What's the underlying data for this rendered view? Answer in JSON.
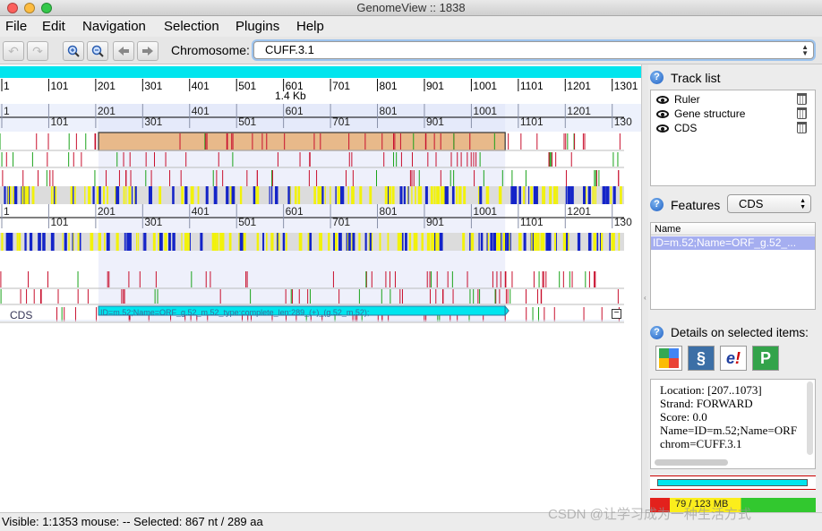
{
  "window": {
    "title": "GenomeView :: 1838"
  },
  "menu": [
    "File",
    "Edit",
    "Navigation",
    "Selection",
    "Plugins",
    "Help"
  ],
  "toolbar": {
    "buttons": [
      "undo-icon",
      "redo-icon",
      "zoom-in-icon",
      "zoom-out-icon",
      "arrow-left-icon",
      "arrow-right-icon"
    ],
    "chromosome_label": "Chromosome:",
    "chromosome_value": "CUFF.3.1"
  },
  "genome": {
    "ruler_ticks": [
      "1",
      "101",
      "201",
      "301",
      "401",
      "501",
      "601",
      "701",
      "801",
      "901",
      "1001",
      "1101",
      "1201",
      "1301"
    ],
    "ruler_tick_positions": [
      1,
      101,
      201,
      301,
      401,
      501,
      601,
      701,
      801,
      901,
      1001,
      1101,
      1201,
      1301
    ],
    "scale_label": "1.4 Kb",
    "nucleotide_ticks": [
      "1",
      "101",
      "201",
      "301",
      "401",
      "501",
      "601",
      "701",
      "801",
      "901",
      "1001",
      "1101",
      "1201",
      "130"
    ],
    "selected_region": [
      207,
      1073
    ],
    "track_label": "CDS",
    "cds_feature_label": "ID=m.52;Name=ORF_g.52_m.52_type:complete_len:289_(+)_(g.52_m.52);",
    "collapse_button": "−",
    "colors": {
      "cyan": "#00e5ee",
      "selection": "#eef0fb",
      "gene": "#e8b98a",
      "red": "#c8102e",
      "green": "#1aa31a",
      "yellow": "#f2f20a",
      "blue": "#1424c8"
    }
  },
  "sidebar": {
    "track_list_title": "Track list",
    "tracks": [
      "Ruler",
      "Gene structure",
      "CDS"
    ],
    "features_title": "Features",
    "features_select": "CDS",
    "features_column": "Name",
    "features_rows": [
      "ID=m.52;Name=ORF_g.52_..."
    ],
    "details_title": "Details on selected items:",
    "details_icons": [
      "google-icon",
      "ncbi-icon",
      "ensembl-icon",
      "pubmed-icon"
    ],
    "details_lines": [
      "Location: [207..1073]",
      "Strand: FORWARD",
      "Score: 0.0",
      "Name=ID=m.52;Name=ORF",
      "chrom=CUFF.3.1"
    ],
    "memory_label": "79 / 123 MB"
  },
  "status": {
    "text": "Visible: 1:1353 mouse: -- Selected: 867 nt / 289 aa",
    "watermark": "CSDN @让学习成为一种生活方式"
  }
}
